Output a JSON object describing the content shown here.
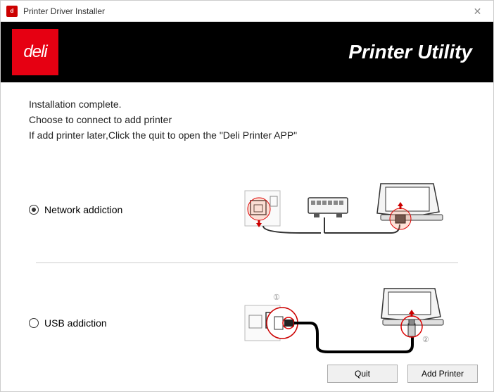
{
  "window": {
    "title": "Printer Driver Installer",
    "icon_label": "deli"
  },
  "header": {
    "logo_text": "deli",
    "title": "Printer Utility"
  },
  "message": {
    "line1": "Installation complete.",
    "line2": " Choose to connect to add printer",
    "line3": "If add printer later,Click the quit to open the \"Deli Printer APP\""
  },
  "options": {
    "network": {
      "label": "Network addiction",
      "checked": true
    },
    "usb": {
      "label": "USB addiction",
      "checked": false
    }
  },
  "buttons": {
    "quit": "Quit",
    "add": "Add Printer"
  }
}
